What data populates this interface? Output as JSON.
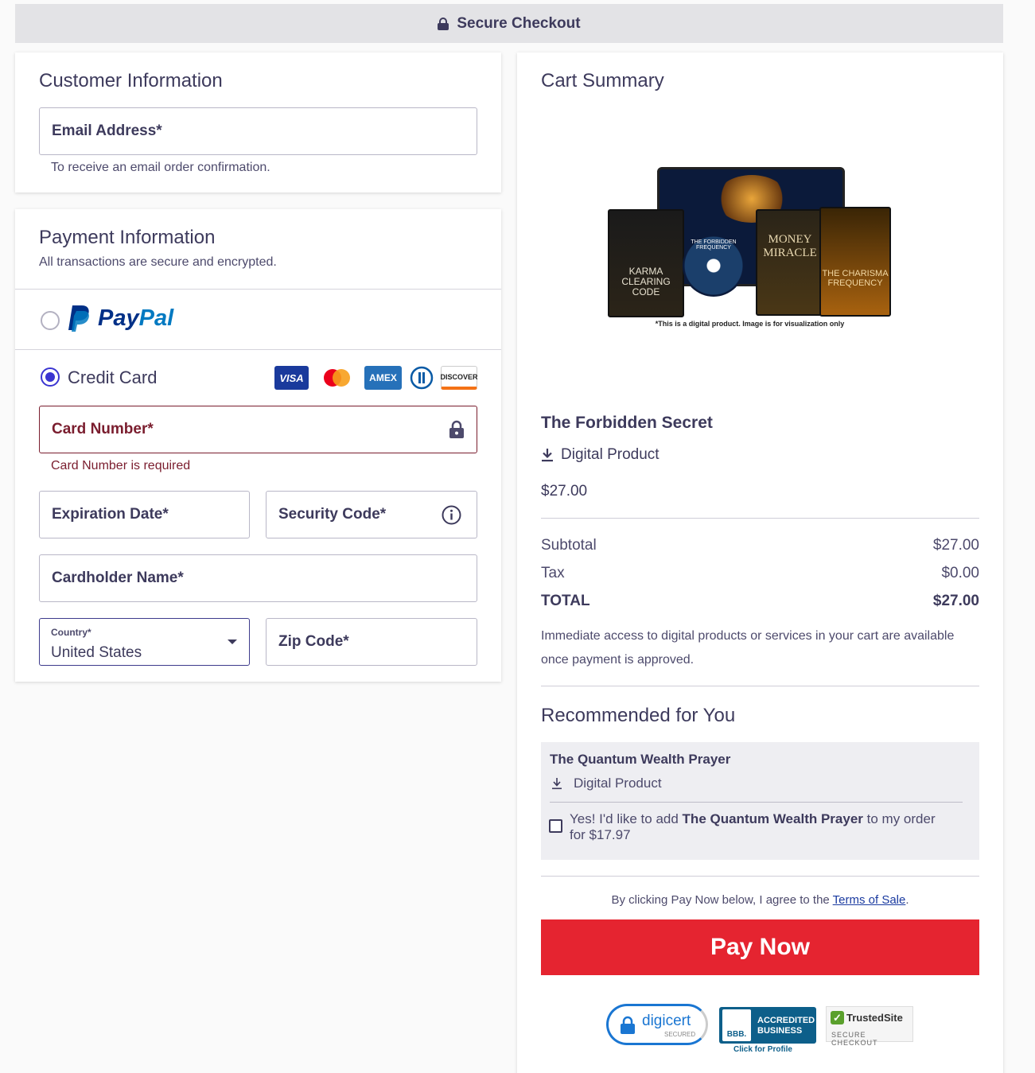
{
  "header": {
    "title": "Secure Checkout"
  },
  "customer": {
    "heading": "Customer Information",
    "email_label": "Email Address*",
    "email_helper": "To receive an email order confirmation."
  },
  "payment": {
    "heading": "Payment Information",
    "subheading": "All transactions are secure and encrypted.",
    "paypal": {
      "pay": "Pay",
      "pal": "Pal"
    },
    "credit_card_label": "Credit Card",
    "card_brands": [
      "VISA",
      "mastercard",
      "AMEX",
      "diners",
      "DISCOVER"
    ],
    "card_number_label": "Card Number*",
    "card_number_error": "Card Number is required",
    "expiration_label": "Expiration Date*",
    "security_code_label": "Security Code*",
    "cardholder_label": "Cardholder Name*",
    "country_label": "Country*",
    "country_value": "United States",
    "zip_label": "Zip Code*"
  },
  "cart": {
    "heading": "Cart Summary",
    "image_caption": "*This is a digital product. Image is for visualization only",
    "image_titles": [
      "KARMA CLEARING CODE",
      "THE FORBIDDEN FREQUENCY",
      "MONEY MIRACLE",
      "THE CHARISMA FREQUENCY"
    ],
    "product_name": "The Forbidden Secret",
    "product_type": "Digital Product",
    "product_price": "$27.00",
    "subtotal_label": "Subtotal",
    "subtotal_value": "$27.00",
    "tax_label": "Tax",
    "tax_value": "$0.00",
    "total_label": "TOTAL",
    "total_value": "$27.00",
    "access_note": "Immediate access to digital products or services in your cart are available once payment is approved."
  },
  "recommended": {
    "heading": "Recommended for You",
    "product_name": "The Quantum Wealth Prayer",
    "product_type": "Digital Product",
    "offer_prefix": "Yes! I'd like to add ",
    "offer_product": "The Quantum Wealth Prayer",
    "offer_suffix": " to my order",
    "offer_price": "for $17.97"
  },
  "terms": {
    "prefix": "By clicking Pay Now below, I agree to the ",
    "link": "Terms of Sale",
    "suffix": "."
  },
  "pay_button": "Pay Now",
  "badges": {
    "digicert": "digicert",
    "digicert_sub": "SECURED",
    "bbb_line1": "ACCREDITED",
    "bbb_line2": "BUSINESS",
    "bbb_logo": "BBB.",
    "bbb_caption": "Click for Profile",
    "trustedsite": "TrustedSite",
    "trustedsite_sub": "SECURE CHECKOUT"
  },
  "colors": {
    "accent": "#3b35d1",
    "error": "#7a1d2e",
    "pay_button": "#e52430",
    "text": "#3d3a5c"
  }
}
